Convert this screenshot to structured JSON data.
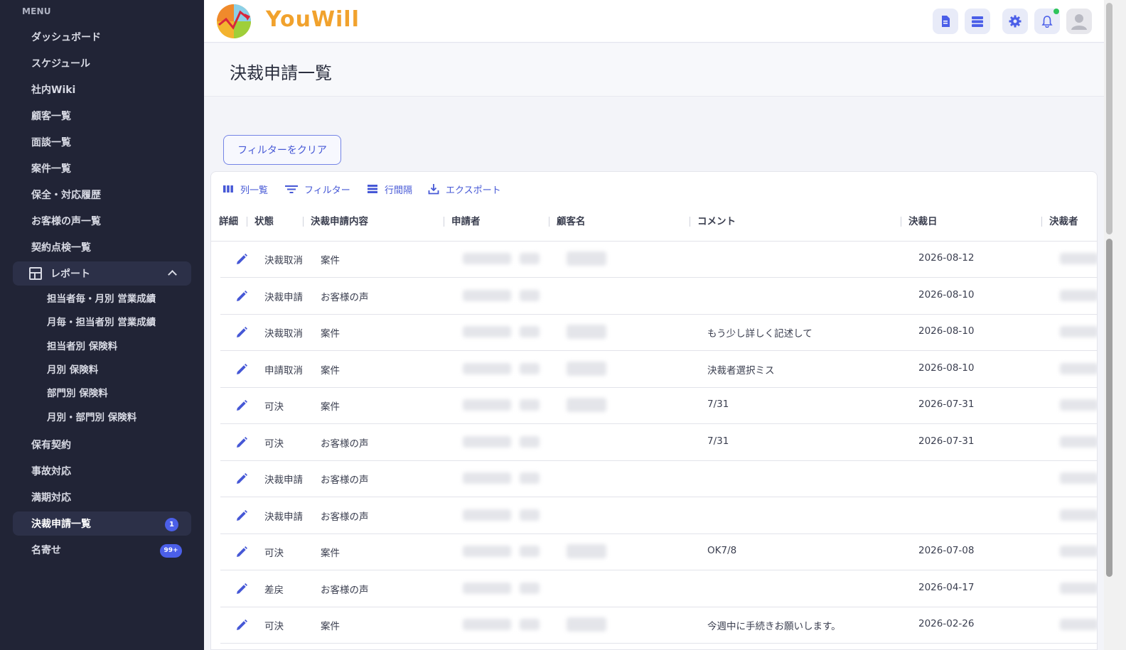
{
  "sidebar": {
    "heading": "MENU",
    "items": [
      {
        "label": "ダッシュボード"
      },
      {
        "label": "スケジュール"
      },
      {
        "label": "社内Wiki"
      },
      {
        "label": "顧客一覧"
      },
      {
        "label": "面談一覧"
      },
      {
        "label": "案件一覧"
      },
      {
        "label": "保全・対応履歴"
      },
      {
        "label": "お客様の声一覧"
      },
      {
        "label": "契約点検一覧"
      }
    ],
    "report_group": {
      "label": "レポート",
      "sub_items": [
        {
          "label": "担当者毎・月別 営業成績"
        },
        {
          "label": "月毎・担当者別 営業成績"
        },
        {
          "label": "担当者別 保険料"
        },
        {
          "label": "月別 保険料"
        },
        {
          "label": "部門別 保険料"
        },
        {
          "label": "月別・部門別 保険料"
        }
      ]
    },
    "items_after": [
      {
        "label": "保有契約"
      },
      {
        "label": "事故対応"
      },
      {
        "label": "満期対応"
      }
    ],
    "approval": {
      "label": "決裁申請一覧",
      "badge": "1"
    },
    "business_cards": {
      "label": "名寄せ",
      "badge": "99+"
    }
  },
  "header": {
    "brand": "YouWill",
    "colors": {
      "brand": "#f1a22d",
      "accent": "#4b5fe8",
      "online": "#2ec45b"
    }
  },
  "page": {
    "title": "決裁申請一覧",
    "clear_filter": "フィルターをクリア"
  },
  "toolbar": {
    "columns": "列一覧",
    "filter": "フィルター",
    "density": "行間隔",
    "export": "エクスポート"
  },
  "table": {
    "columns": [
      "詳細",
      "状態",
      "決裁申請内容",
      "申請者",
      "顧客名",
      "コメント",
      "決裁日",
      "決裁者"
    ],
    "rows": [
      {
        "status": "決裁取消",
        "type": "案件",
        "comment": "",
        "date": "2026-08-12"
      },
      {
        "status": "決裁申請",
        "type": "お客様の声",
        "comment": "",
        "date": "2026-08-10"
      },
      {
        "status": "決裁取消",
        "type": "案件",
        "comment": "もう少し詳しく記述して",
        "date": "2026-08-10"
      },
      {
        "status": "申請取消",
        "type": "案件",
        "comment": "決裁者選択ミス",
        "date": "2026-08-10"
      },
      {
        "status": "可決",
        "type": "案件",
        "comment": "7/31",
        "date": "2026-07-31"
      },
      {
        "status": "可決",
        "type": "お客様の声",
        "comment": "7/31",
        "date": "2026-07-31"
      },
      {
        "status": "決裁申請",
        "type": "お客様の声",
        "comment": "",
        "date": ""
      },
      {
        "status": "決裁申請",
        "type": "お客様の声",
        "comment": "",
        "date": ""
      },
      {
        "status": "可決",
        "type": "案件",
        "comment": "OK7/8",
        "date": "2026-07-08"
      },
      {
        "status": "差戻",
        "type": "お客様の声",
        "comment": "",
        "date": "2026-04-17"
      },
      {
        "status": "可決",
        "type": "案件",
        "comment": "今週中に手続きお願いします。",
        "date": "2026-02-26"
      }
    ]
  }
}
